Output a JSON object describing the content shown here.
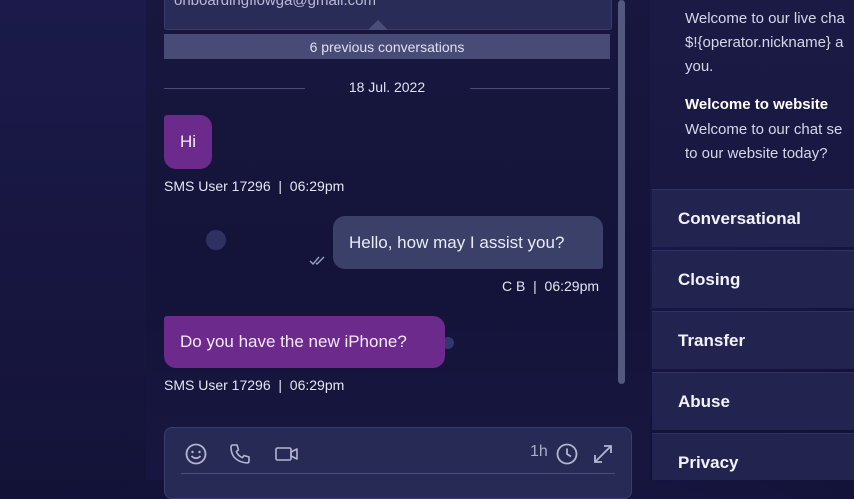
{
  "chat": {
    "partial_email": "onboardingflowga@gmail.com",
    "previous_conversations": "6 previous conversations",
    "date_separator": "18 Jul. 2022",
    "messages": [
      {
        "text": "Hi",
        "meta": "SMS User 17296  |  06:29pm",
        "direction": "incoming"
      },
      {
        "text": "Hello, how may I assist you?",
        "meta": "C B  |  06:29pm",
        "direction": "outgoing",
        "status": "read"
      },
      {
        "text": "Do you have the new iPhone?",
        "meta": "SMS User 17296  |  06:29pm",
        "direction": "incoming"
      }
    ]
  },
  "composer": {
    "icons": [
      "emoji-icon",
      "phone-icon",
      "video-icon",
      "clock-icon",
      "expand-icon"
    ],
    "timer_label": "1h"
  },
  "canned_panel": {
    "lines": [
      {
        "text": "Welcome to our live cha",
        "style": "text"
      },
      {
        "text": "$!{operator.nickname} a",
        "style": "text"
      },
      {
        "text": "you.",
        "style": "text"
      },
      {
        "text": "Welcome to website",
        "style": "title"
      },
      {
        "text": "Welcome to our chat se",
        "style": "text"
      },
      {
        "text": "to our website today?",
        "style": "text"
      }
    ],
    "categories": [
      "Conversational",
      "Closing",
      "Transfer",
      "Abuse",
      "Privacy"
    ]
  },
  "colors": {
    "incoming_bubble": "#6b2a8c",
    "outgoing_bubble": "#3b4069",
    "background": "#14143c"
  }
}
